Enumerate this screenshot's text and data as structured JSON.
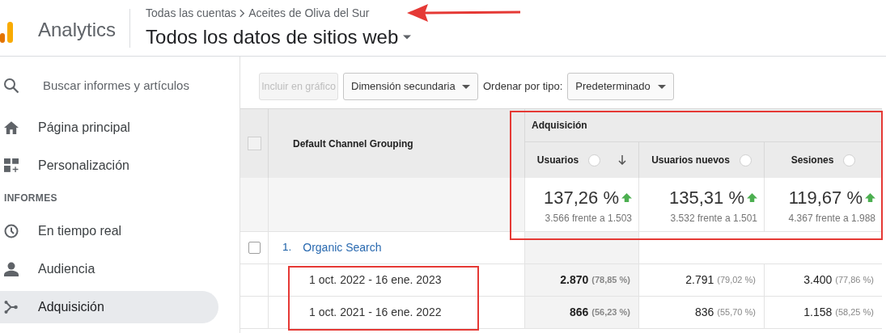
{
  "header": {
    "product": "Analytics",
    "breadcrumb": [
      "Todas las cuentas",
      "Aceites de Oliva del Sur"
    ],
    "view": "Todos los datos de sitios web"
  },
  "sidebar": {
    "search_placeholder": "Buscar informes y artículos",
    "items": [
      {
        "label": "Página principal",
        "selected": false
      },
      {
        "label": "Personalización",
        "selected": false
      }
    ],
    "section": "INFORMES",
    "report_items": [
      {
        "label": "En tiempo real",
        "selected": false
      },
      {
        "label": "Audiencia",
        "selected": false
      },
      {
        "label": "Adquisición",
        "selected": true
      }
    ]
  },
  "toolbar": {
    "include_button": {
      "label": "Incluir en gráfico",
      "disabled": true
    },
    "secondary_dimension": "Dimensión secundaria",
    "sort_label": "Ordenar por tipo:",
    "sort_value": "Predeterminado"
  },
  "table": {
    "select_all_checked": false,
    "dimension_header": "Default Channel Grouping",
    "group": "Adquisición",
    "columns": [
      {
        "label": "Usuarios",
        "sorted": true
      },
      {
        "label": "Usuarios nuevos",
        "sorted": false
      },
      {
        "label": "Sesiones",
        "sorted": false
      }
    ],
    "summary": [
      {
        "value": "137,26 %",
        "detail": "3.566 frente a 1.503",
        "rising": true
      },
      {
        "value": "135,31 %",
        "detail": "3.532 frente a 1.501",
        "rising": true
      },
      {
        "value": "119,67 %",
        "detail": "4.367 frente a 1.988",
        "rising": true
      }
    ],
    "rows": [
      {
        "kind": "group",
        "index": "1.",
        "label": "Organic Search",
        "checked": false
      },
      {
        "kind": "period",
        "label": "1 oct. 2022 - 16 ene. 2023",
        "cells": [
          {
            "value": "2.870",
            "share": "(78,85 %)"
          },
          {
            "value": "2.791",
            "share": "(79,02 %)"
          },
          {
            "value": "3.400",
            "share": "(77,86 %)"
          }
        ]
      },
      {
        "kind": "period",
        "label": "1 oct. 2021 - 16 ene. 2022",
        "cells": [
          {
            "value": "866",
            "share": "(56,23 %)"
          },
          {
            "value": "836",
            "share": "(55,70 %)"
          },
          {
            "value": "1.158",
            "share": "(58,25 %)"
          }
        ]
      }
    ]
  }
}
